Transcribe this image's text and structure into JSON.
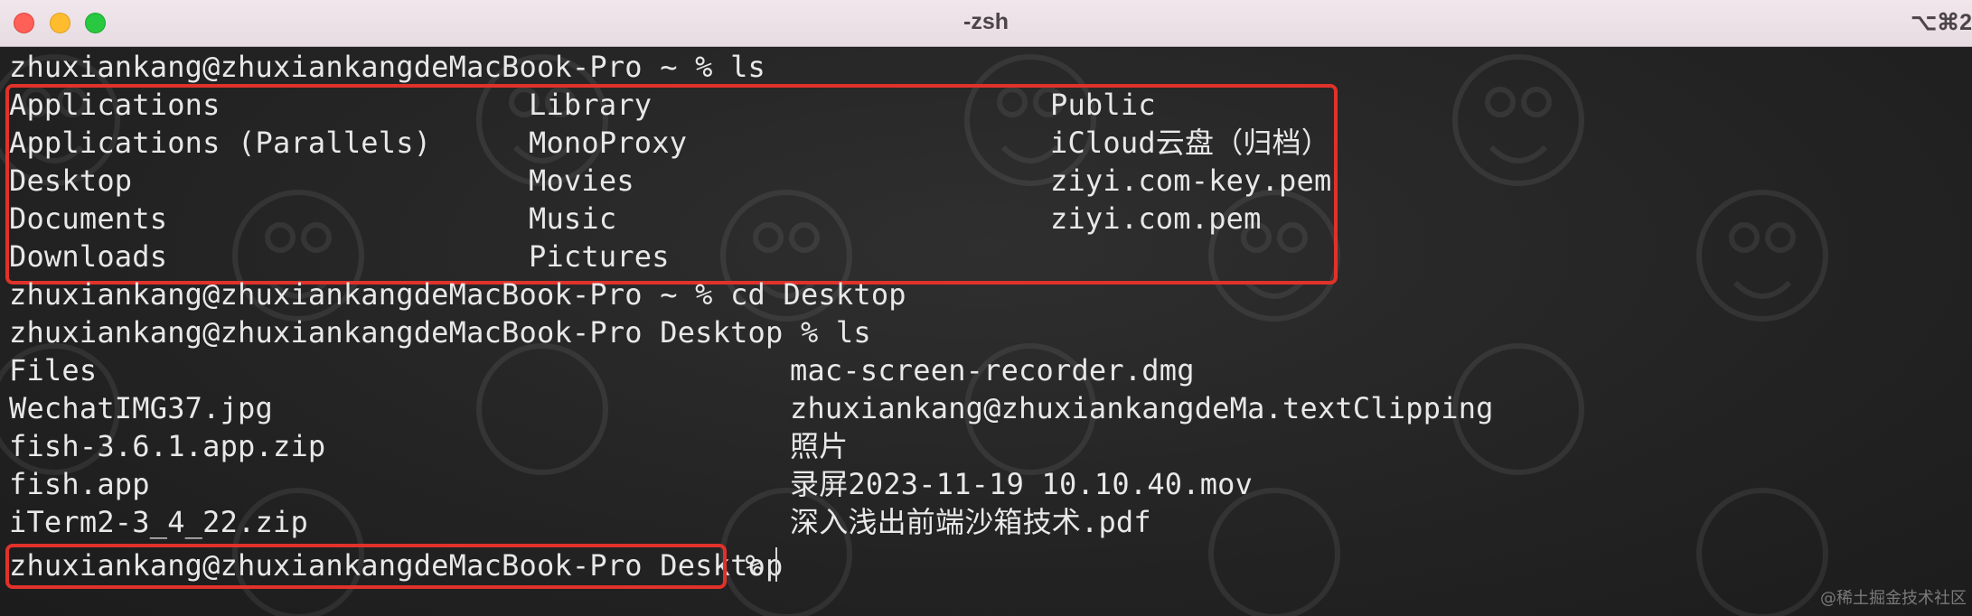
{
  "window": {
    "title": "-zsh",
    "shortcut": "⌥⌘2"
  },
  "terminal": {
    "prompt1": "zhuxiankang@zhuxiankangdeMacBook-Pro ~ % ls",
    "ls_home": {
      "col1": [
        "Applications",
        "Applications (Parallels)",
        "Desktop",
        "Documents",
        "Downloads"
      ],
      "col2": [
        "Library",
        "MonoProxy",
        "Movies",
        "Music",
        "Pictures"
      ],
      "col3": [
        "Public",
        "iCloud云盘（归档）",
        "ziyi.com-key.pem",
        "ziyi.com.pem",
        ""
      ]
    },
    "prompt2": "zhuxiankang@zhuxiankangdeMacBook-Pro ~ % cd Desktop",
    "prompt3": "zhuxiankang@zhuxiankangdeMacBook-Pro Desktop % ls",
    "ls_desktop": {
      "col1": [
        "Files",
        "WechatIMG37.jpg",
        "fish-3.6.1.app.zip",
        "fish.app",
        "iTerm2-3_4_22.zip"
      ],
      "col2": [
        "mac-screen-recorder.dmg",
        "zhuxiankang@zhuxiankangdeMa.textClipping",
        "照片",
        "录屏2023-11-19 10.10.40.mov",
        "深入浅出前端沙箱技术.pdf"
      ]
    },
    "prompt4_highlighted": "zhuxiankang@zhuxiankangdeMacBook-Pro Desktop",
    "prompt4_suffix": " %"
  },
  "watermark": "@稀土掘金技术社区",
  "colors": {
    "highlight_border": "#e0322a",
    "text": "#e8e8e8",
    "background": "#232323"
  }
}
